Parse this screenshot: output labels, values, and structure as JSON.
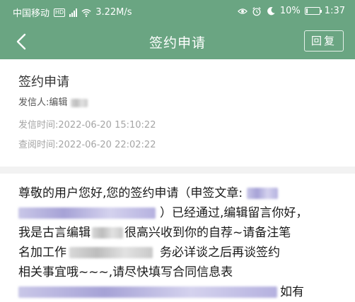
{
  "status_bar": {
    "carrier": "中国移动",
    "hd": "HD",
    "network_speed": "3.22M/s",
    "battery": "10%",
    "battery_level": 0.1,
    "time": "1:37"
  },
  "header": {
    "title": "签约申请",
    "reply_label": "回复"
  },
  "mail": {
    "subject": "签约申请",
    "sender_label": "发信人:",
    "sender_value": "编辑",
    "sent_time_label": "发信时间:",
    "sent_time_value": "2022-06-20 15:10:22",
    "read_time_label": "查阅时间:",
    "read_time_value": "2022-06-20 22:02:22",
    "body": {
      "line1": "尊敬的用户您好,您的签约申请（申签文章:",
      "line2_a": "）已经通过,编辑留言你好，",
      "line3_a": "我是古言编辑",
      "line3_b": "很高兴收到你的自荐~请备注笔",
      "line4_a": "名加工作",
      "line4_b": "务必详谈之后再谈签约",
      "line5": "相关事宜哦~~~,请尽快填写合同信息表",
      "line6_b": "如有"
    }
  },
  "colors": {
    "primary": "#6aa582",
    "divider": "#f2f2f2"
  },
  "icons": [
    "signal-icon",
    "wifi-icon",
    "eye-icon",
    "alarm-icon",
    "moon-icon",
    "battery-icon",
    "back-arrow-icon"
  ]
}
